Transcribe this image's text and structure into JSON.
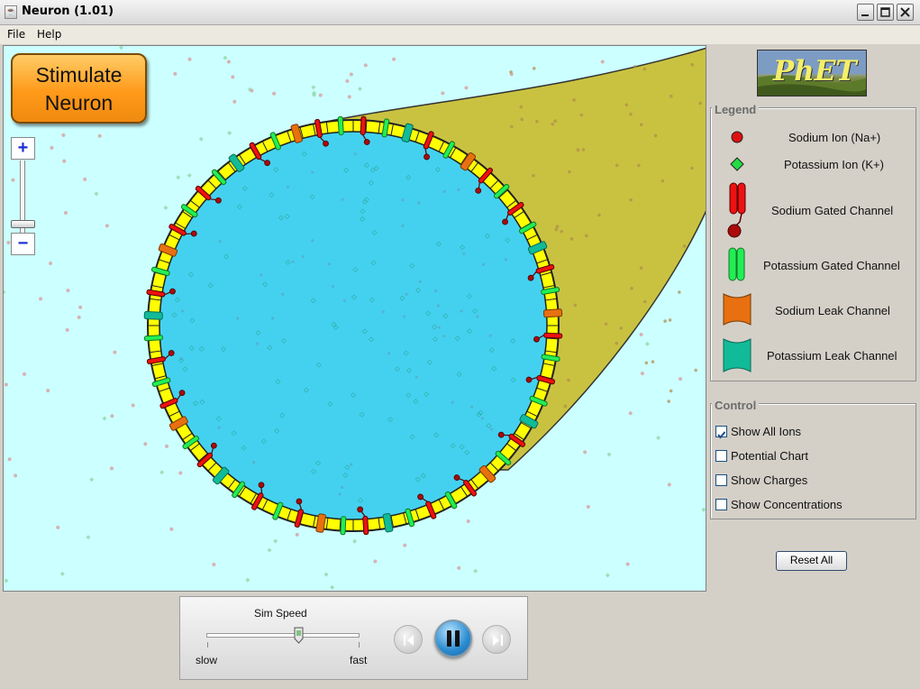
{
  "window": {
    "title": "Neuron (1.01)"
  },
  "menu": {
    "file": "File",
    "help": "Help"
  },
  "canvas": {
    "stimulate_button": "Stimulate\nNeuron",
    "zoom_in": "+",
    "zoom_out": "−",
    "colors": {
      "background": "#ccffff",
      "cell_interior": "#44d1f0",
      "membrane": "#ffff00",
      "axon": "#c8c040"
    }
  },
  "logo": {
    "text": "PhET"
  },
  "legend": {
    "title": "Legend",
    "items": [
      {
        "label": "Sodium Ion (Na+)",
        "icon": "sodium-ion-icon",
        "color": "#e01010"
      },
      {
        "label": "Potassium Ion (K+)",
        "icon": "potassium-ion-icon",
        "color": "#22dd44"
      },
      {
        "label": "Sodium Gated Channel",
        "icon": "sodium-gated-channel-icon",
        "color": "#ee1111"
      },
      {
        "label": "Potassium Gated Channel",
        "icon": "potassium-gated-channel-icon",
        "color": "#22ee55"
      },
      {
        "label": "Sodium Leak Channel",
        "icon": "sodium-leak-channel-icon",
        "color": "#e87010"
      },
      {
        "label": "Potassium Leak Channel",
        "icon": "potassium-leak-channel-icon",
        "color": "#11bb99"
      }
    ]
  },
  "control": {
    "title": "Control",
    "options": [
      {
        "label": "Show All Ions",
        "checked": true
      },
      {
        "label": "Potential Chart",
        "checked": false
      },
      {
        "label": "Show Charges",
        "checked": false
      },
      {
        "label": "Show Concentrations",
        "checked": false
      }
    ]
  },
  "reset_all": "Reset All",
  "speed": {
    "label": "Sim Speed",
    "slow": "slow",
    "fast": "fast",
    "value_fraction": 0.6
  }
}
